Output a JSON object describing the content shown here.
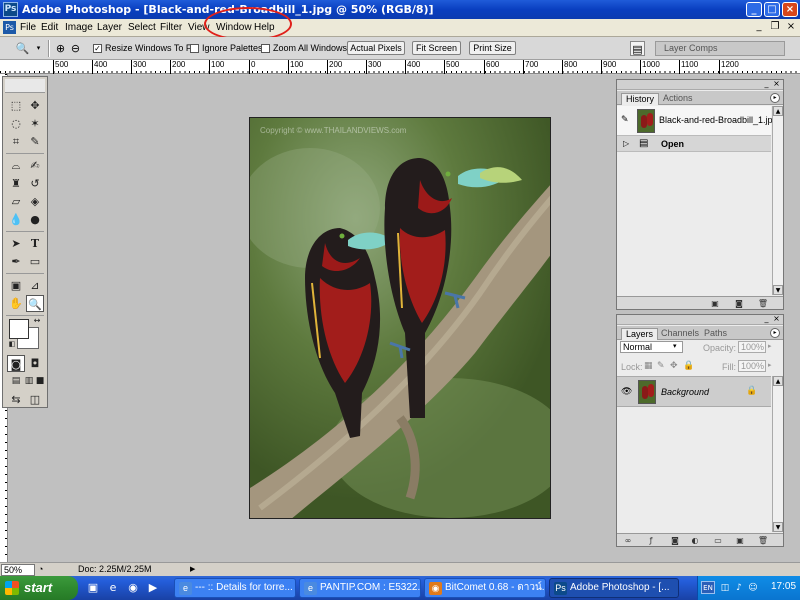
{
  "window": {
    "title": "Adobe Photoshop - [Black-and-red-Broadbill_1.jpg @ 50% (RGB/8)]",
    "app_icon": "photoshop-icon"
  },
  "menu": [
    "File",
    "Edit",
    "Image",
    "Layer",
    "Select",
    "Filter",
    "View",
    "Window",
    "Help"
  ],
  "options_bar": {
    "resize_windows_label": "Resize Windows To Fit",
    "resize_windows_checked": true,
    "ignore_palettes_label": "Ignore Palettes",
    "ignore_palettes_checked": false,
    "zoom_all_label": "Zoom All Windows",
    "zoom_all_checked": false,
    "actual_pixels": "Actual Pixels",
    "fit_screen": "Fit Screen",
    "print_size": "Print Size",
    "palette_well_tab": "Layer Comps"
  },
  "ruler_labels": [
    "500",
    "400",
    "300",
    "200",
    "100",
    "0",
    "100",
    "200",
    "300",
    "400",
    "500",
    "600",
    "700",
    "800",
    "900",
    "1000",
    "1100",
    "1200"
  ],
  "document": {
    "watermark": "Copyright © www.THAILANDVIEWS.com"
  },
  "history_panel": {
    "tabs": [
      "History",
      "Actions"
    ],
    "snapshot_name": "Black-and-red-Broadbill_1.jpg",
    "states": [
      "Open"
    ]
  },
  "layers_panel": {
    "tabs": [
      "Layers",
      "Channels",
      "Paths"
    ],
    "blend_mode": "Normal",
    "opacity_label": "Opacity:",
    "opacity_value": "100%",
    "lock_label": "Lock:",
    "fill_label": "Fill:",
    "fill_value": "100%",
    "layers": [
      "Background"
    ]
  },
  "status_bar": {
    "zoom": "50%",
    "doc_info": "Doc: 2.25M/2.25M"
  },
  "taskbar": {
    "start_label": "start",
    "tasks": [
      {
        "label": "--- :: Details for torre...",
        "icon": "browser-icon",
        "active": false
      },
      {
        "label": "PANTIP.COM : E5322...",
        "icon": "browser-icon",
        "active": false
      },
      {
        "label": "BitComet 0.68 - ดาวน์...",
        "icon": "bitcomet-icon",
        "active": false
      },
      {
        "label": "Adobe Photoshop - [...",
        "icon": "photoshop-icon",
        "active": true
      }
    ],
    "language": "EN",
    "clock": "17:05"
  },
  "colors": {
    "title_bar": "#0a3fc0",
    "annotation_circle": "#e0201a",
    "start_button": "#2f8a2f",
    "bird_red": "#a21d1b"
  }
}
